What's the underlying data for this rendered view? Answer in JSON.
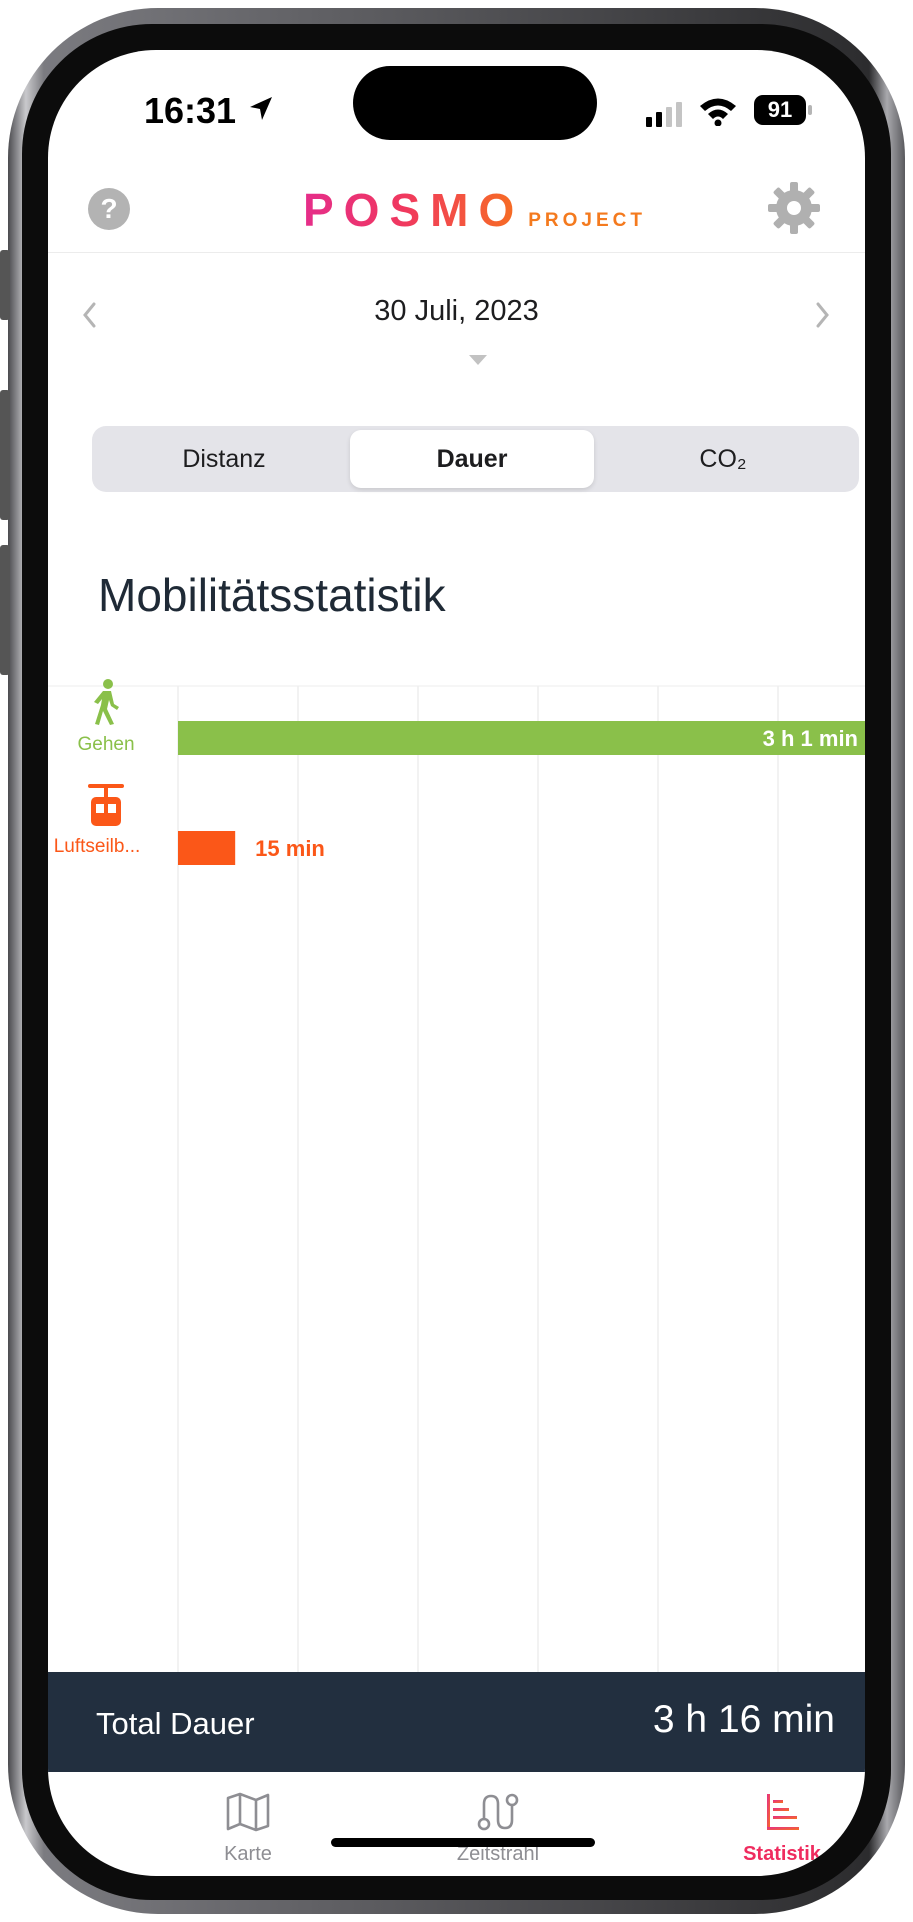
{
  "status_bar": {
    "time": "16:31",
    "battery": "91"
  },
  "header": {
    "help_label": "?",
    "logo_main": "POSMO",
    "logo_sub": "PROJECT"
  },
  "date_nav": {
    "date": "30 Juli, 2023"
  },
  "segments": [
    {
      "label": "Distanz",
      "selected": false
    },
    {
      "label": "Dauer",
      "selected": true
    },
    {
      "label": "CO₂",
      "selected": false
    }
  ],
  "section_title": "Mobilitätsstatistik",
  "chart_data": {
    "type": "bar",
    "orientation": "horizontal",
    "unit": "min",
    "categories": [
      "Gehen",
      "Luftseilb..."
    ],
    "values": [
      181,
      15
    ],
    "value_labels": [
      "3 h 1 min",
      "15 min"
    ],
    "colors": [
      "#8ac04a",
      "#fb5718"
    ],
    "xlim": [
      0,
      181
    ],
    "grid": true
  },
  "total": {
    "label": "Total Dauer",
    "value": "3 h 16 min"
  },
  "tabs": [
    {
      "label": "Karte",
      "icon": "map-icon",
      "active": false
    },
    {
      "label": "Zeitstrahl",
      "icon": "timeline-icon",
      "active": false
    },
    {
      "label": "Statistik",
      "icon": "bar-chart-icon",
      "active": true
    }
  ]
}
